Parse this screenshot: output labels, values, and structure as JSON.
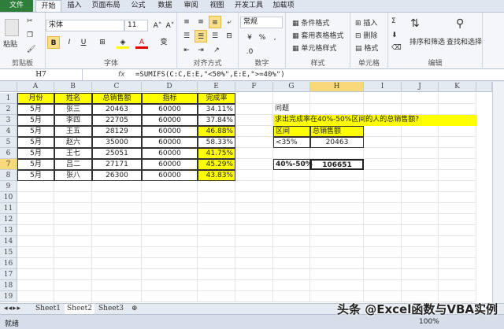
{
  "ribbon_tabs": [
    "文件",
    "开始",
    "插入",
    "页面布局",
    "公式",
    "数据",
    "审阅",
    "视图",
    "开发工具",
    "加载项"
  ],
  "active_tab": 1,
  "clipboard": {
    "paste": "粘贴",
    "group": "剪贴板"
  },
  "font": {
    "name": "宋体",
    "size": "11",
    "bold": "B",
    "italic": "I",
    "underline": "U",
    "group": "字体",
    "grow": "A˄",
    "shrink": "A˅",
    "color_glyph": "A",
    "wen": "变"
  },
  "align": {
    "group": "对齐方式"
  },
  "number": {
    "format": "常规",
    "percent": "%",
    "comma": ",",
    "group": "数字"
  },
  "styles": {
    "items": [
      "条件格式",
      "套用表格格式",
      "单元格样式"
    ],
    "group": "样式"
  },
  "cells": {
    "items": [
      "插入",
      "删除",
      "格式"
    ],
    "group": "单元格"
  },
  "editing": {
    "sum": "Σ",
    "sort": "排序和筛选",
    "find": "查找和选择",
    "group": "编辑"
  },
  "formula_bar": {
    "name_box": "H7",
    "fx": "fx",
    "formula": "=SUMIFS(C:C,E:E,\"<50%\",E:E,\">=40%\")"
  },
  "columns": [
    "A",
    "B",
    "C",
    "D",
    "E",
    "F",
    "G",
    "H",
    "I",
    "J",
    "K"
  ],
  "selected_column": "H",
  "selected_row": 7,
  "row_count": 19,
  "table": {
    "headers": [
      "月份",
      "姓名",
      "总销售额",
      "指标",
      "完成率"
    ],
    "rows": [
      [
        "5月",
        "张三",
        "20463",
        "60000",
        "34.11%"
      ],
      [
        "5月",
        "李四",
        "22705",
        "60000",
        "37.84%"
      ],
      [
        "5月",
        "王五",
        "28129",
        "60000",
        "46.88%"
      ],
      [
        "5月",
        "赵六",
        "35000",
        "60000",
        "58.33%"
      ],
      [
        "5月",
        "王七",
        "25051",
        "60000",
        "41.75%"
      ],
      [
        "5月",
        "吕二",
        "27171",
        "60000",
        "45.29%"
      ],
      [
        "5月",
        "张八",
        "26300",
        "60000",
        "43.83%"
      ]
    ],
    "highlighted_rows": [
      2,
      4,
      5,
      6
    ]
  },
  "question": {
    "label": "问题",
    "text": "求出完成率在40%-50%区间的人的总销售额?",
    "h1": "区间",
    "h2": "总销售额",
    "r1": [
      "<35%",
      "20463"
    ],
    "r2": [
      "40%-50%",
      "106651"
    ]
  },
  "sheets": [
    "Sheet1",
    "Sheet2",
    "Sheet3"
  ],
  "active_sheet": 1,
  "status": {
    "ready": "就绪",
    "zoom": "100%"
  },
  "watermark": "头条 @Excel函数与VBA实例",
  "colors": {
    "highlight": "#ffff00",
    "file_tab": "#2f7d3a",
    "selected_header": "#f8d878"
  }
}
